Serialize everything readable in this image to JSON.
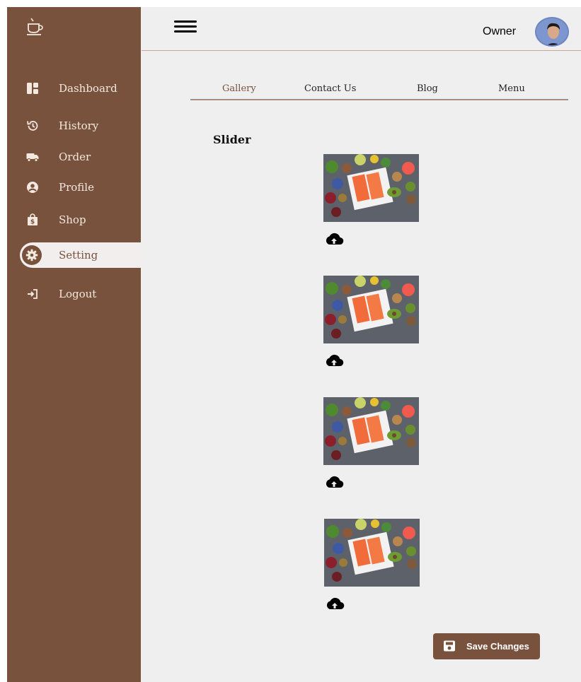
{
  "header": {
    "user_name": "Owner"
  },
  "sidebar": {
    "items": [
      {
        "label": "Dashboard",
        "icon": "dashboard-icon"
      },
      {
        "label": "History",
        "icon": "history-icon"
      },
      {
        "label": "Order",
        "icon": "truck-icon"
      },
      {
        "label": "Profile",
        "icon": "user-circle-icon"
      },
      {
        "label": "Shop",
        "icon": "shopping-bag-icon"
      },
      {
        "label": "Setting",
        "icon": "gear-icon",
        "active": true
      },
      {
        "label": "Logout",
        "icon": "logout-icon"
      }
    ]
  },
  "tabs": [
    {
      "label": "Gallery",
      "active": true
    },
    {
      "label": "Contact Us"
    },
    {
      "label": "Blog"
    },
    {
      "label": "Menu"
    }
  ],
  "section": {
    "title": "Slider"
  },
  "slides": [
    {
      "icon": "upload-cloud-icon"
    },
    {
      "icon": "upload-cloud-icon"
    },
    {
      "icon": "upload-cloud-icon"
    },
    {
      "icon": "upload-cloud-icon"
    }
  ],
  "actions": {
    "save_label": "Save Changes"
  },
  "colors": {
    "brand": "#79523d",
    "background": "#efefef",
    "text_light": "#f3e9df"
  }
}
